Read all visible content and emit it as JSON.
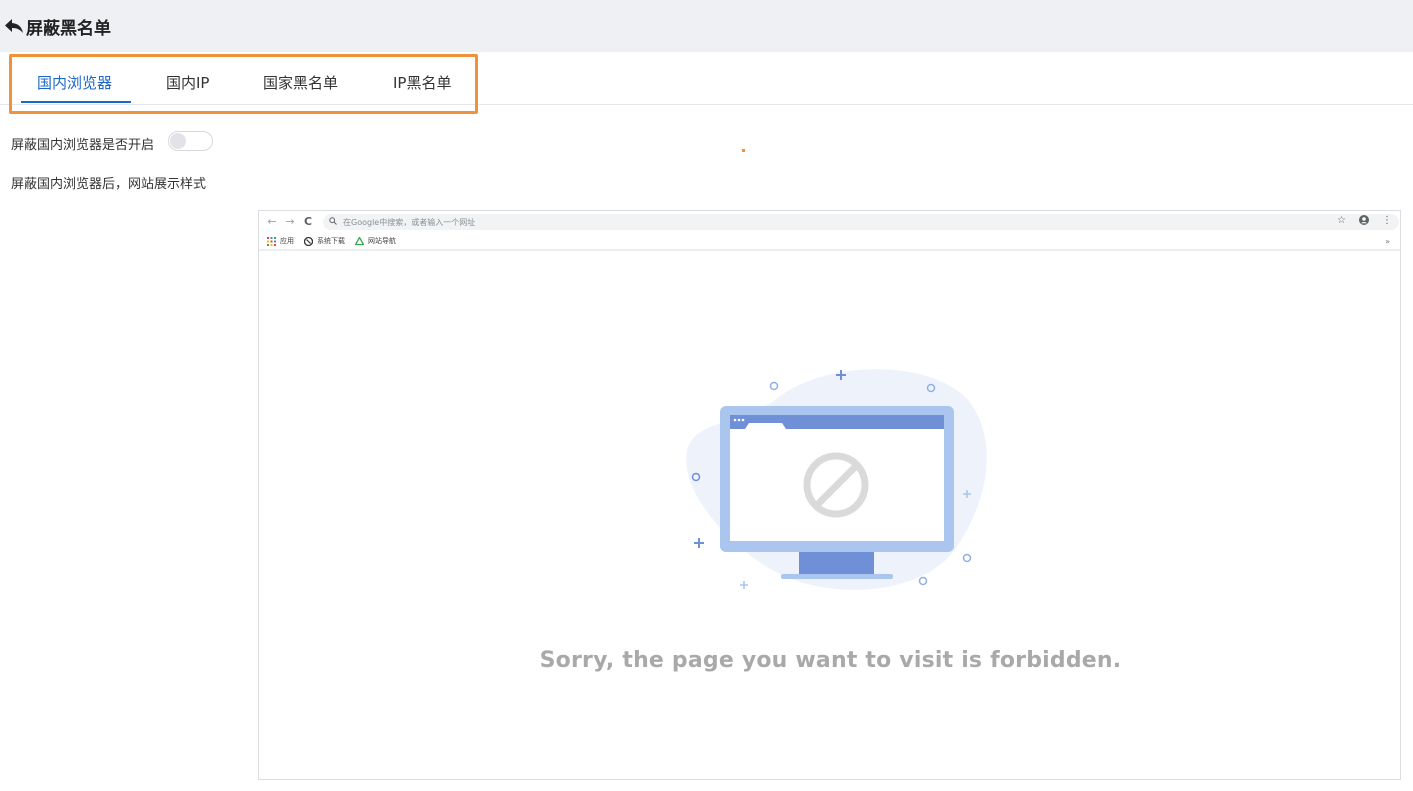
{
  "header": {
    "back_icon": "arrow-back-icon",
    "title": "屏蔽黑名单"
  },
  "tabs": [
    {
      "label": "国内浏览器",
      "active": true
    },
    {
      "label": "国内IP",
      "active": false
    },
    {
      "label": "国家黑名单",
      "active": false
    },
    {
      "label": "IP黑名单",
      "active": false
    }
  ],
  "settings": {
    "toggle_label": "屏蔽国内浏览器是否开启",
    "toggle_on": false,
    "style_label": "屏蔽国内浏览器后，网站展示样式"
  },
  "preview": {
    "omnibox_placeholder": "在Google中搜索，或者输入一个网址",
    "bookmarks": [
      {
        "label": "应用",
        "icon": "apps-grid-icon"
      },
      {
        "label": "系统下载",
        "icon": "globe-icon"
      },
      {
        "label": "网站导航",
        "icon": "recycle-icon"
      }
    ],
    "message": "Sorry, the page you want to visit is forbidden."
  },
  "colors": {
    "accent": "#1d68c4",
    "highlight_border": "#f0923a",
    "header_bg": "#eef0f4",
    "illustration_blue": "#6f8fd6",
    "illustration_light": "#aac6ee"
  }
}
